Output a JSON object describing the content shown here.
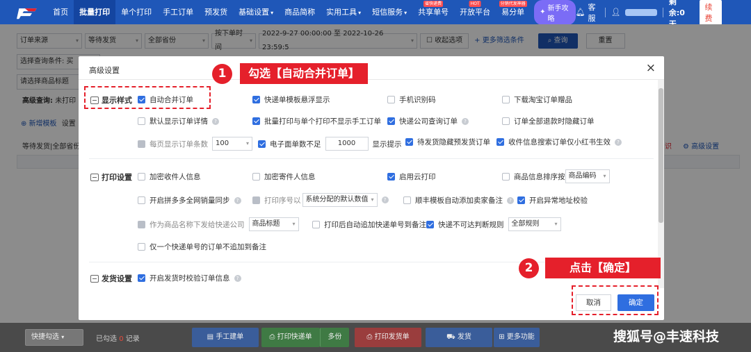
{
  "nav": {
    "items": [
      {
        "label": "首页",
        "active": false
      },
      {
        "label": "批量打印",
        "active": true
      },
      {
        "label": "单个打印",
        "active": false
      },
      {
        "label": "手工订单",
        "active": false
      },
      {
        "label": "预发货",
        "active": false
      },
      {
        "label": "基础设置",
        "active": false,
        "dropdown": true
      },
      {
        "label": "商品简称",
        "active": false
      },
      {
        "label": "实用工具",
        "active": false,
        "dropdown": true
      },
      {
        "label": "短信服务",
        "active": false,
        "dropdown": true
      },
      {
        "label": "共享单号",
        "active": false,
        "badge": "省快递费"
      },
      {
        "label": "开放平台",
        "active": false,
        "badge": "HOT"
      },
      {
        "label": "易分单",
        "active": false,
        "badge": "分销代发神器"
      }
    ],
    "guide_label": "新手攻略",
    "service_label": "客服",
    "remaining_label": "剩余:0天",
    "renew_label": "续费"
  },
  "filters": {
    "row1": [
      "订单来源",
      "等待发货",
      "全部省份",
      "按下单时间"
    ],
    "date_range": "2022-9-27 00:00:00 至 2022-10-26 23:59:5",
    "collapse_label": "收起选项",
    "more_filter_label": "+ 更多筛选条件",
    "query_label": "查询",
    "reset_label": "重置",
    "query_conditions_label": "选择查询条件: 买",
    "product_title_label": "请选择商品标题",
    "advanced_query_label": "高级查询:",
    "advanced_query_value": "未打印",
    "new_template_label": "新增模板",
    "settings_short": "设置",
    "pending_label": "等待发货|全部省份",
    "advanced_settings_link": "高级设置",
    "right_fragment": "识"
  },
  "modal": {
    "title": "高级设置",
    "sections": {
      "display": "显示样式",
      "print": "打印设置",
      "ship": "发货设置"
    },
    "display_options": {
      "auto_merge": "自动合并订单",
      "template_float": "快递单模板悬浮显示",
      "phone_recognize": "手机识别码",
      "download_taobao_gift": "下载淘宝订单赠品",
      "default_detail": "默认显示订单详情",
      "batch_hide_manual": "批量打印与单个打印不显示手工订单",
      "express_query": "快递公司查询订单",
      "hide_refund": "订单全部退款时隐藏订单",
      "per_page": "每页显示订单条数",
      "per_page_value": "100",
      "low_sheet": "电子面单数不足",
      "low_sheet_value": "1000",
      "low_sheet_suffix": "显示提示",
      "hide_presale": "待发货隐藏预发货订单",
      "xhs_search": "收件信息搜索订单仅小红书生效"
    },
    "print_options": {
      "encrypt_receiver": "加密收件人信息",
      "encrypt_sender": "加密寄件人信息",
      "cloud_print": "启用云打印",
      "sort_by": "商品信息排序按",
      "sort_value": "商品编码",
      "pdd_sync": "开启拼多多全网销量同步",
      "print_seq": "打印序号以",
      "print_seq_value": "系统分配的默认数值",
      "sf_remark": "顺丰模板自动添加卖家备注",
      "abnormal_addr": "开启异常地址校验",
      "as_product_name": "作为商品名称下发给快递公司",
      "product_name_value": "商品标题",
      "append_tracking": "打印后自动追加快递单号到备注",
      "unreachable": "快递不可达判断规则",
      "unreachable_value": "全部规则",
      "single_tracking": "仅一个快递单号的订单不追加到备注"
    },
    "ship_options": {
      "verify_on_ship": "开启发货时校验订单信息"
    },
    "cancel_label": "取消",
    "ok_label": "确定",
    "close_glyph": "×"
  },
  "bottom": {
    "quick_select": "快捷勾选",
    "selected_prefix": "已勾选",
    "selected_count": "0",
    "selected_suffix": "记录",
    "manual_order": "手工建单",
    "print_express": "打印快递单",
    "multi_copies": "多份",
    "print_invoice": "打印发货单",
    "ship": "发货",
    "more": "更多功能"
  },
  "annotations": {
    "step1_num": "1",
    "step1_text": "勾选【自动合并订单】",
    "step2_num": "2",
    "step2_text": "点击【确定】",
    "watermark": "搜狐号@丰速科技"
  },
  "colors": {
    "nav_blue": "#1f57b8",
    "primary": "#2f6ee0",
    "annotation_red": "#e5202b"
  }
}
